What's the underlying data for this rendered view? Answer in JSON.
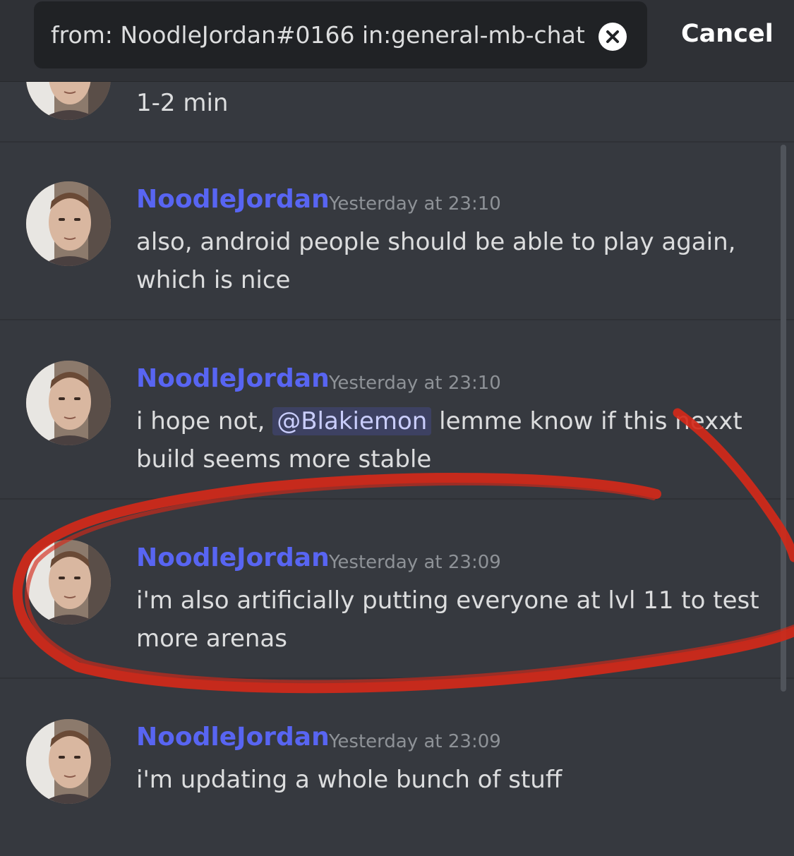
{
  "search": {
    "query": "from: NoodleJordan#0166 in:general-mb-chat",
    "cancel_label": "Cancel",
    "clear_icon": "close-icon"
  },
  "partial_message": {
    "text": "1-2 min"
  },
  "messages": [
    {
      "username": "NoodleJordan",
      "timestamp": "Yesterday at 23:10",
      "line1": "also, android people should be able to play again,",
      "line2": "which is nice"
    },
    {
      "username": "NoodleJordan",
      "timestamp": "Yesterday at 23:10",
      "line1_before": "i hope not,",
      "mention": "@Blakiemon",
      "line1_after": "lemme know if this nexxt",
      "line2": "build seems more stable"
    },
    {
      "username": "NoodleJordan",
      "timestamp": "Yesterday at 23:09",
      "line1": "i'm also artificially putting everyone at lvl 11 to test",
      "line2": "more arenas"
    },
    {
      "username": "NoodleJordan",
      "timestamp": "Yesterday at 23:09",
      "line1": "i'm updating a whole bunch of stuff",
      "line2": ""
    }
  ],
  "colors": {
    "background": "#36393f",
    "username": "#5865f2",
    "annotation": "#d42a1a"
  }
}
